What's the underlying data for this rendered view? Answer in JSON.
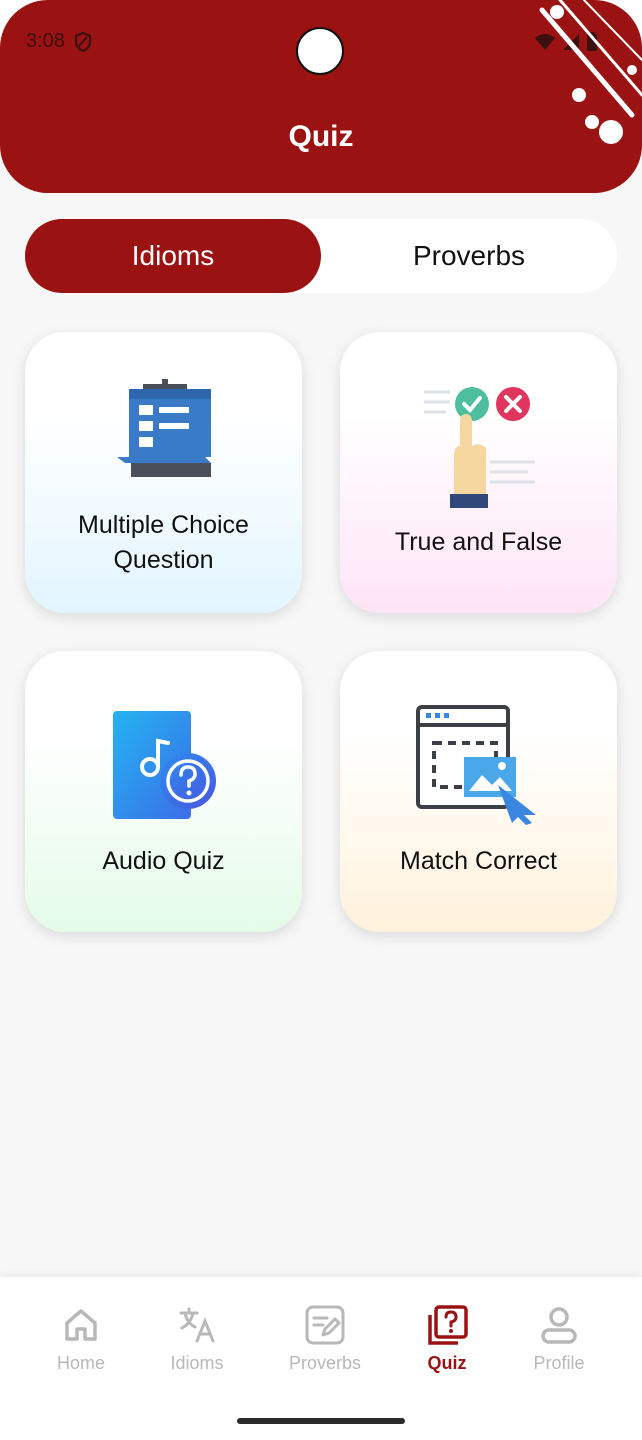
{
  "status_bar": {
    "time": "3:08"
  },
  "header": {
    "title": "Quiz"
  },
  "tabs": {
    "active": "Idioms",
    "inactive": "Proverbs"
  },
  "cards": [
    {
      "label_line1": "Multiple Choice",
      "label_line2": "Question",
      "icon": "clipboard-list-icon"
    },
    {
      "label": "True and False",
      "icon": "true-false-hand-icon"
    },
    {
      "label": "Audio Quiz",
      "icon": "audio-question-icon"
    },
    {
      "label": "Match Correct",
      "icon": "match-window-icon"
    }
  ],
  "bottom_nav": {
    "items": [
      {
        "label": "Home",
        "icon": "home-icon"
      },
      {
        "label": "Idioms",
        "icon": "translate-icon"
      },
      {
        "label": "Proverbs",
        "icon": "edit-note-icon"
      },
      {
        "label": "Quiz",
        "icon": "quiz-icon"
      },
      {
        "label": "Profile",
        "icon": "profile-icon"
      }
    ],
    "active_index": 3
  },
  "colors": {
    "primary": "#9b1212",
    "background": "#f7f7f7",
    "inactive_nav": "#b8b8b8"
  }
}
